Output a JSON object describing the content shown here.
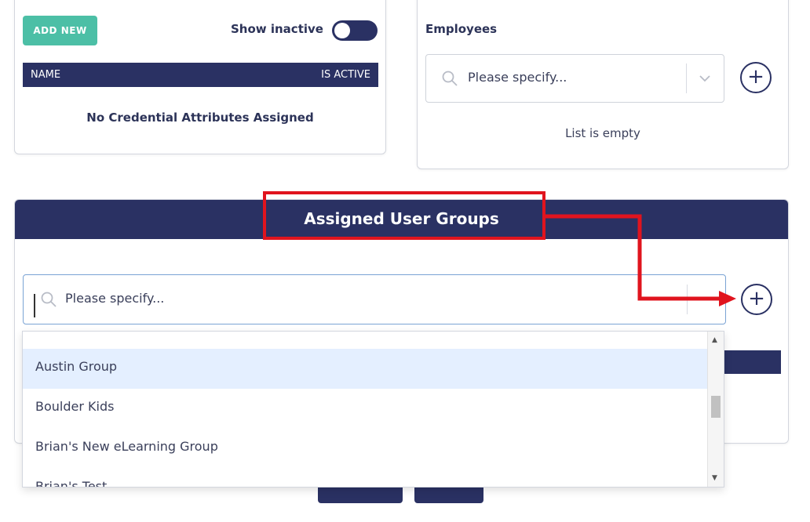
{
  "credentials_card": {
    "add_new_label": "ADD NEW",
    "show_inactive_label": "Show inactive",
    "table_headers": {
      "name": "NAME",
      "is_active": "IS ACTIVE"
    },
    "empty_message": "No Credential Attributes Assigned"
  },
  "employees_card": {
    "title": "Employees",
    "select_placeholder": "Please specify...",
    "empty_message": "List is empty"
  },
  "user_groups_card": {
    "title": "Assigned User Groups",
    "select_placeholder": "Please specify..."
  },
  "dropdown": {
    "items": [
      {
        "label": "Austin Group"
      },
      {
        "label": "Boulder Kids"
      },
      {
        "label": "Brian's New eLearning Group"
      },
      {
        "label": "Brian's Test"
      }
    ]
  },
  "colors": {
    "navy": "#2a3163",
    "teal": "#4cbfa6",
    "annotation_red": "#e0141e",
    "highlight": "#e4efff"
  },
  "icons": [
    "search-icon",
    "chevron-down-icon",
    "plus-circle-icon",
    "arrow-right-icon"
  ]
}
